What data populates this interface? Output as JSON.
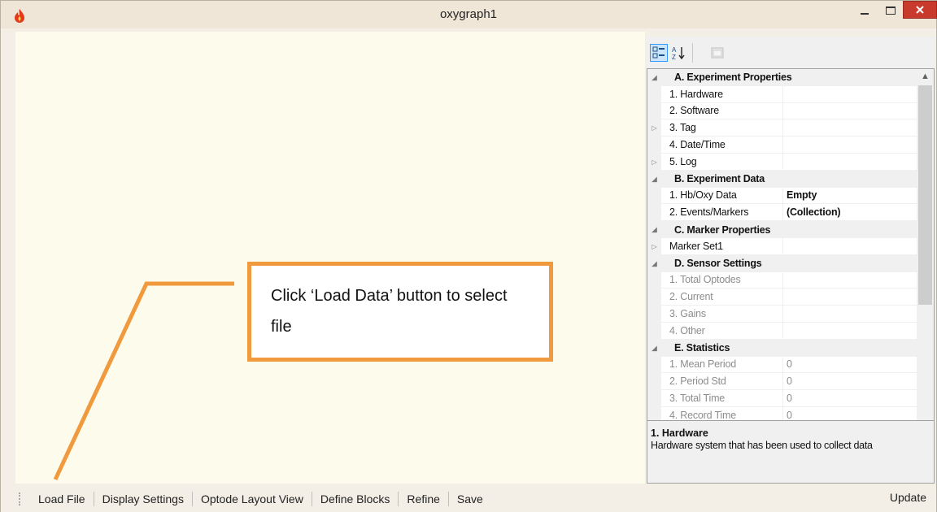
{
  "window": {
    "title": "oxygraph1"
  },
  "property_grid": {
    "rows": [
      {
        "kind": "category",
        "label": "A. Experiment Properties"
      },
      {
        "kind": "prop",
        "label": "1. Hardware",
        "value": "",
        "selected": true
      },
      {
        "kind": "prop",
        "label": "2. Software",
        "value": ""
      },
      {
        "kind": "prop",
        "label": "3. Tag",
        "value": "",
        "expandable": true
      },
      {
        "kind": "prop",
        "label": "4. Date/Time",
        "value": ""
      },
      {
        "kind": "prop",
        "label": "5. Log",
        "value": "",
        "expandable": true
      },
      {
        "kind": "category",
        "label": "B. Experiment Data"
      },
      {
        "kind": "prop",
        "label": "1. Hb/Oxy Data",
        "value": "Empty",
        "bold": true
      },
      {
        "kind": "prop",
        "label": "2. Events/Markers",
        "value": "(Collection)",
        "bold": true
      },
      {
        "kind": "category",
        "label": "C. Marker Properties"
      },
      {
        "kind": "prop",
        "label": "Marker Set1",
        "value": "",
        "expandable": true
      },
      {
        "kind": "category",
        "label": "D. Sensor Settings"
      },
      {
        "kind": "prop",
        "label": "1. Total Optodes",
        "value": "",
        "disabled": true
      },
      {
        "kind": "prop",
        "label": "2. Current",
        "value": "",
        "disabled": true
      },
      {
        "kind": "prop",
        "label": "3. Gains",
        "value": "",
        "disabled": true
      },
      {
        "kind": "prop",
        "label": "4. Other",
        "value": "",
        "disabled": true
      },
      {
        "kind": "category",
        "label": "E. Statistics"
      },
      {
        "kind": "prop",
        "label": "1. Mean Period",
        "value": "0",
        "disabled": true
      },
      {
        "kind": "prop",
        "label": "2. Period Std",
        "value": "0",
        "disabled": true
      },
      {
        "kind": "prop",
        "label": "3. Total Time",
        "value": "0",
        "disabled": true
      },
      {
        "kind": "prop",
        "label": "4. Record Time",
        "value": "0",
        "disabled": true
      }
    ],
    "help": {
      "title": "1. Hardware",
      "description": "Hardware system that has been used to collect data"
    }
  },
  "toolstrip": {
    "items": [
      "Load File",
      "Display Settings",
      "Optode Layout View",
      "Define Blocks",
      "Refine",
      "Save"
    ],
    "update_label": "Update"
  },
  "callout": {
    "text": "Click ‘Load Data’ button to select file"
  },
  "colors": {
    "callout_accent": "#f0993d",
    "canvas_background": "#fdfcec",
    "close_button": "#c83a2c"
  }
}
